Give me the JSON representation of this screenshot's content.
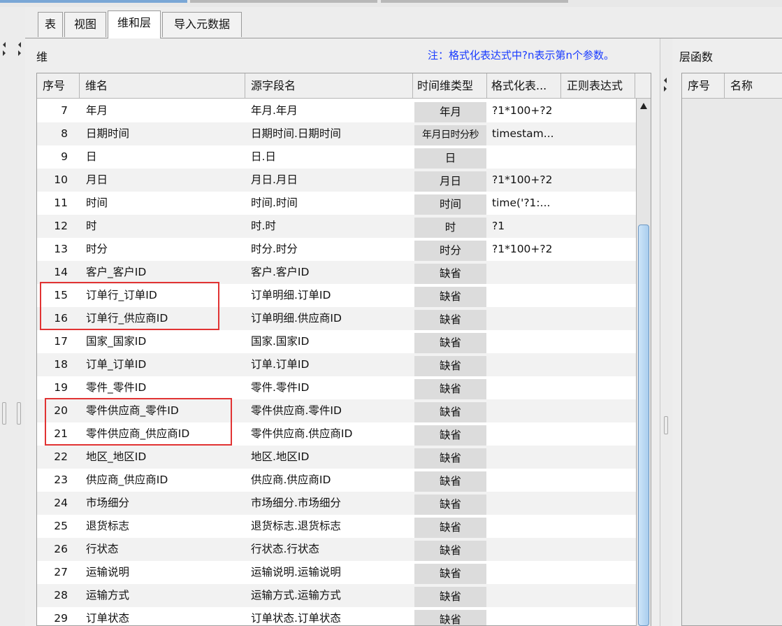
{
  "tabs": [
    "表",
    "视图",
    "维和层",
    "导入元数据"
  ],
  "active_tab": "维和层",
  "panel": {
    "title": "维",
    "note": "注：格式化表达式中?n表示第n个参数。"
  },
  "table": {
    "columns": [
      "序号",
      "维名",
      "源字段名",
      "时间维类型",
      "格式化表...",
      "正则表达式"
    ],
    "rows": [
      {
        "no": "7",
        "name": "年月",
        "source": "年月.年月",
        "time_type": "年月",
        "format": "?1*100+?2",
        "regex": ""
      },
      {
        "no": "8",
        "name": "日期时间",
        "source": "日期时间.日期时间",
        "time_type": "年月日时分秒",
        "format": "timestam...",
        "regex": ""
      },
      {
        "no": "9",
        "name": "日",
        "source": "日.日",
        "time_type": "日",
        "format": "",
        "regex": ""
      },
      {
        "no": "10",
        "name": "月日",
        "source": "月日.月日",
        "time_type": "月日",
        "format": "?1*100+?2",
        "regex": ""
      },
      {
        "no": "11",
        "name": "时间",
        "source": "时间.时间",
        "time_type": "时间",
        "format": "time('?1:...",
        "regex": ""
      },
      {
        "no": "12",
        "name": "时",
        "source": "时.时",
        "time_type": "时",
        "format": "?1",
        "regex": ""
      },
      {
        "no": "13",
        "name": "时分",
        "source": "时分.时分",
        "time_type": "时分",
        "format": "?1*100+?2",
        "regex": ""
      },
      {
        "no": "14",
        "name": "客户_客户ID",
        "source": "客户.客户ID",
        "time_type": "缺省",
        "format": "",
        "regex": ""
      },
      {
        "no": "15",
        "name": "订单行_订单ID",
        "source": "订单明细.订单ID",
        "time_type": "缺省",
        "format": "",
        "regex": ""
      },
      {
        "no": "16",
        "name": "订单行_供应商ID",
        "source": "订单明细.供应商ID",
        "time_type": "缺省",
        "format": "",
        "regex": ""
      },
      {
        "no": "17",
        "name": "国家_国家ID",
        "source": "国家.国家ID",
        "time_type": "缺省",
        "format": "",
        "regex": ""
      },
      {
        "no": "18",
        "name": "订单_订单ID",
        "source": "订单.订单ID",
        "time_type": "缺省",
        "format": "",
        "regex": ""
      },
      {
        "no": "19",
        "name": "零件_零件ID",
        "source": "零件.零件ID",
        "time_type": "缺省",
        "format": "",
        "regex": ""
      },
      {
        "no": "20",
        "name": "零件供应商_零件ID",
        "source": "零件供应商.零件ID",
        "time_type": "缺省",
        "format": "",
        "regex": ""
      },
      {
        "no": "21",
        "name": "零件供应商_供应商ID",
        "source": "零件供应商.供应商ID",
        "time_type": "缺省",
        "format": "",
        "regex": ""
      },
      {
        "no": "22",
        "name": "地区_地区ID",
        "source": "地区.地区ID",
        "time_type": "缺省",
        "format": "",
        "regex": ""
      },
      {
        "no": "23",
        "name": "供应商_供应商ID",
        "source": "供应商.供应商ID",
        "time_type": "缺省",
        "format": "",
        "regex": ""
      },
      {
        "no": "24",
        "name": "市场细分",
        "source": "市场细分.市场细分",
        "time_type": "缺省",
        "format": "",
        "regex": ""
      },
      {
        "no": "25",
        "name": "退货标志",
        "source": "退货标志.退货标志",
        "time_type": "缺省",
        "format": "",
        "regex": ""
      },
      {
        "no": "26",
        "name": "行状态",
        "source": "行状态.行状态",
        "time_type": "缺省",
        "format": "",
        "regex": ""
      },
      {
        "no": "27",
        "name": "运输说明",
        "source": "运输说明.运输说明",
        "time_type": "缺省",
        "format": "",
        "regex": ""
      },
      {
        "no": "28",
        "name": "运输方式",
        "source": "运输方式.运输方式",
        "time_type": "缺省",
        "format": "",
        "regex": ""
      },
      {
        "no": "29",
        "name": "订单状态",
        "source": "订单状态.订单状态",
        "time_type": "缺省",
        "format": "",
        "regex": ""
      }
    ],
    "highlighted_rows": [
      [
        "15",
        "16"
      ],
      [
        "20",
        "21"
      ]
    ]
  },
  "right_panel": {
    "title": "层函数",
    "columns": [
      "序号",
      "名称"
    ]
  },
  "colors": {
    "note": "#1a3cff",
    "highlight": "#e13333",
    "scroll_thumb": "#a9cdee"
  }
}
